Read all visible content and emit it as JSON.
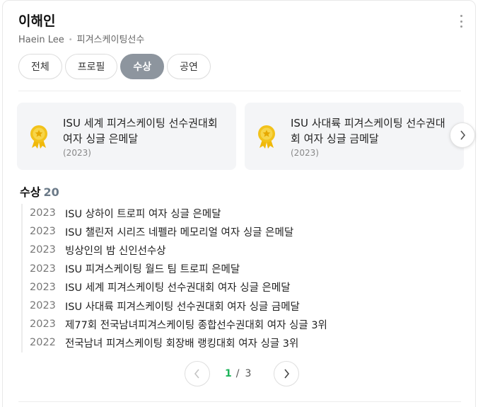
{
  "profile": {
    "name": "이해인",
    "english_name": "Haein Lee",
    "occupation": "피겨스케이팅선수"
  },
  "tabs": [
    {
      "label": "전체",
      "active": false
    },
    {
      "label": "프로필",
      "active": false
    },
    {
      "label": "수상",
      "active": true
    },
    {
      "label": "공연",
      "active": false
    }
  ],
  "featured_awards": [
    {
      "title": "ISU 세계 피겨스케이팅 선수권대회 여자 싱글 은메달",
      "year": "(2023)",
      "icon": "medal-icon"
    },
    {
      "title": "ISU 사대륙 피겨스케이팅 선수권대회 여자 싱글 금메달",
      "year": "(2023)",
      "icon": "medal-icon"
    }
  ],
  "awards_section": {
    "title": "수상",
    "count": "20",
    "items": [
      {
        "year": "2023",
        "title": "ISU 상하이 트로피 여자 싱글 은메달"
      },
      {
        "year": "2023",
        "title": "ISU 챌린저 시리즈 네펠라 메모리얼 여자 싱글 은메달"
      },
      {
        "year": "2023",
        "title": "빙상인의 밤 신인선수상"
      },
      {
        "year": "2023",
        "title": "ISU 피겨스케이팅 월드 팀 트로피 은메달"
      },
      {
        "year": "2023",
        "title": "ISU 세계 피겨스케이팅 선수권대회 여자 싱글 은메달"
      },
      {
        "year": "2023",
        "title": "ISU 사대륙 피겨스케이팅 선수권대회 여자 싱글 금메달"
      },
      {
        "year": "2023",
        "title": "제77회 전국남녀피겨스케이팅 종합선수권대회 여자 싱글 3위"
      },
      {
        "year": "2022",
        "title": "전국남녀 피겨스케이팅 회장배 랭킹대회 여자 싱글 3위"
      }
    ]
  },
  "pagination": {
    "current": "1",
    "separator": "/",
    "total": "3"
  },
  "colors": {
    "active_tab": "#8d959e",
    "current_page": "#1db45a",
    "medal_gold": "#f2c21b"
  }
}
